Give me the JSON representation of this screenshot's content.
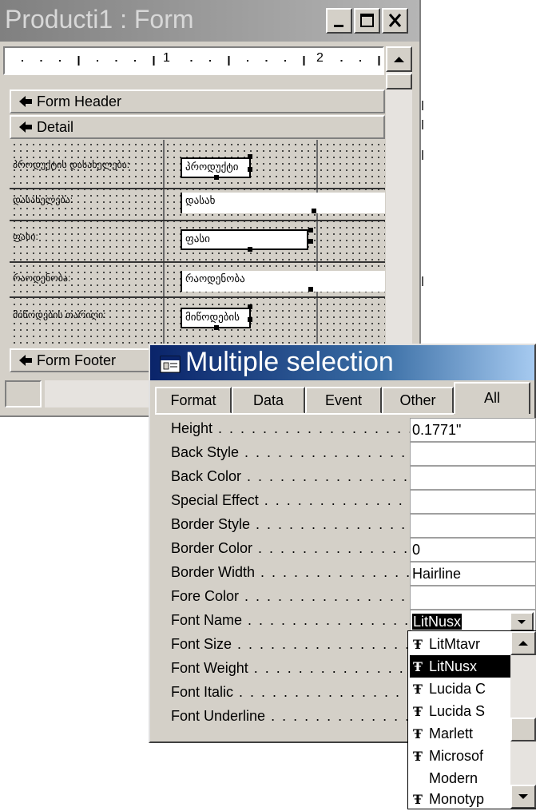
{
  "form_window": {
    "title": "Producti1 : Form",
    "buttons": {
      "minimize": "minimize-icon",
      "maximize": "maximize-icon",
      "close": "close-icon"
    },
    "ruler": {
      "marks": [
        "1",
        "2"
      ]
    },
    "sections": {
      "form_header": "Form Header",
      "detail": "Detail",
      "form_footer": "Form Footer"
    },
    "fields": [
      {
        "label": "პროდუქტის დასახელება:",
        "control": "პროდუქტი"
      },
      {
        "label": "დასახელება:",
        "control": "დასახ"
      },
      {
        "label": "ფასი:",
        "control": "ფასი"
      },
      {
        "label": "რაოდენობა:",
        "control": "რაოდენობა"
      },
      {
        "label": "მიწოდების თარიღი:",
        "control": "მიწოდების"
      }
    ]
  },
  "property_sheet": {
    "title": "Multiple selection",
    "tabs": [
      "Format",
      "Data",
      "Event",
      "Other",
      "All"
    ],
    "active_tab": "All",
    "properties": [
      {
        "name": "Height",
        "value": "0.1771\""
      },
      {
        "name": "Back Style",
        "value": ""
      },
      {
        "name": "Back Color",
        "value": ""
      },
      {
        "name": "Special Effect",
        "value": ""
      },
      {
        "name": "Border Style",
        "value": ""
      },
      {
        "name": "Border Color",
        "value": "0"
      },
      {
        "name": "Border Width",
        "value": "Hairline"
      },
      {
        "name": "Fore Color",
        "value": ""
      },
      {
        "name": "Font Name",
        "value": "LitNusx"
      },
      {
        "name": "Font Size",
        "value": ""
      },
      {
        "name": "Font Weight",
        "value": ""
      },
      {
        "name": "Font Italic",
        "value": ""
      },
      {
        "name": "Font Underline",
        "value": ""
      }
    ],
    "font_dropdown": {
      "glyph": "Ŧ",
      "items": [
        {
          "label": "LitMtavr",
          "icon": "truetype-icon"
        },
        {
          "label": "LitNusx",
          "icon": "truetype-icon"
        },
        {
          "label": "Lucida C",
          "icon": "truetype-icon"
        },
        {
          "label": "Lucida S",
          "icon": "truetype-icon"
        },
        {
          "label": "Marlett",
          "icon": "truetype-icon"
        },
        {
          "label": "Microsof",
          "icon": "truetype-icon"
        },
        {
          "label": "Modern",
          "icon": ""
        },
        {
          "label": "Monotyp",
          "icon": "truetype-icon"
        }
      ],
      "selected": "LitNusx"
    }
  },
  "colors": {
    "active_title": "#0a246a",
    "inactive_title": "#808080",
    "face": "#d4d0c8"
  }
}
